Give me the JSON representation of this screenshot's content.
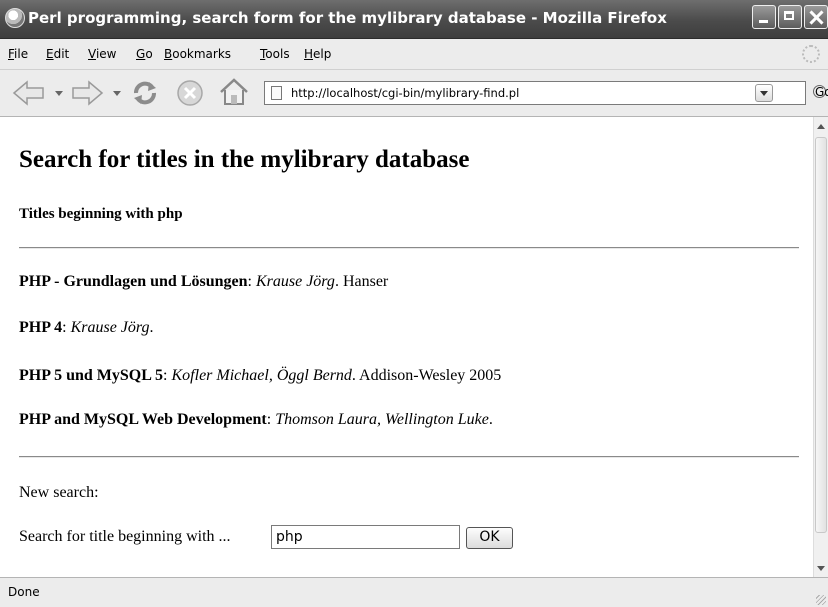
{
  "window": {
    "title": "Perl programming, search form for the mylibrary database - Mozilla Firefox"
  },
  "menu": {
    "items": [
      {
        "label": "File",
        "accel": "F",
        "rest": "ile"
      },
      {
        "label": "Edit",
        "accel": "E",
        "rest": "dit"
      },
      {
        "label": "View",
        "accel": "V",
        "rest": "iew"
      },
      {
        "label": "Go",
        "accel": "G",
        "rest": "o"
      },
      {
        "label": "Bookmarks",
        "accel": "B",
        "rest": "ookmarks"
      },
      {
        "label": "Tools",
        "accel": "T",
        "rest": "ools"
      },
      {
        "label": "Help",
        "accel": "H",
        "rest": "elp"
      }
    ]
  },
  "toolbar": {
    "url": "http://localhost/cgi-bin/mylibrary-find.pl",
    "go_label": "Go"
  },
  "page": {
    "heading": "Search for titles in the mylibrary database",
    "subheading": "Titles beginning with php",
    "results": [
      {
        "title": "PHP - Grundlagen und Lösungen",
        "sep": ": ",
        "authors": "Krause Jörg",
        "publisher": ". Hanser"
      },
      {
        "title": "PHP 4",
        "sep": ": ",
        "authors": "Krause Jörg",
        "publisher": "."
      },
      {
        "title": "PHP 5 und MySQL 5",
        "sep": ": ",
        "authors": "Kofler Michael, Öggl Bernd",
        "publisher": ". Addison-Wesley 2005"
      },
      {
        "title": "PHP and MySQL Web Development",
        "sep": ": ",
        "authors": "Thomson Laura, Wellington Luke",
        "publisher": "."
      }
    ],
    "new_search": "New search:",
    "search_label": "Search for title beginning with ...",
    "search_value": "php",
    "ok_label": "OK"
  },
  "status": {
    "text": "Done"
  },
  "icons": [
    "firefox-icon",
    "back-arrow-icon",
    "forward-arrow-icon",
    "reload-icon",
    "stop-icon",
    "home-icon",
    "page-icon",
    "go-arrow-icon",
    "throbber-icon"
  ]
}
